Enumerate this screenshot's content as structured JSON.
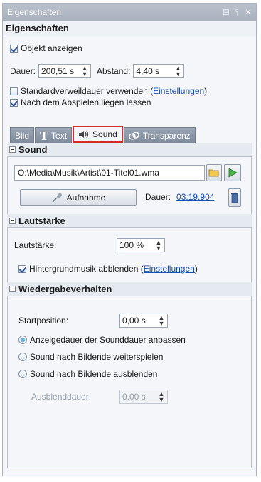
{
  "window": {
    "title": "Eigenschaften",
    "btn_pin": "⊟",
    "btn_float": "⫯",
    "btn_close": "✕"
  },
  "header": {
    "title": "Eigenschaften"
  },
  "general": {
    "show_object": {
      "label": "Objekt anzeigen",
      "checked": true
    },
    "duration_label": "Dauer:",
    "duration_value": "200,51 s",
    "distance_label": "Abstand:",
    "distance_value": "4,40 s",
    "default_duration": {
      "label": "Standardverweildauer verwenden (",
      "link": "Einstellungen",
      "suffix": ")",
      "checked": false
    },
    "stay_after_play": {
      "label": "Nach dem Abspielen liegen lassen",
      "checked": true
    }
  },
  "tabs": [
    {
      "label": "Bild",
      "icon": "picture-icon"
    },
    {
      "label": "Text",
      "icon": "text-icon"
    },
    {
      "label": "Sound",
      "icon": "speaker-icon",
      "active": true
    },
    {
      "label": "Transparenz",
      "icon": "transparency-icon"
    }
  ],
  "sound_section": {
    "title": "Sound",
    "file_path": "O:\\Media\\Musik\\Artist\\01-Titel01.wma",
    "record_button": "Aufnahme",
    "duration_label": "Dauer:",
    "duration_link": "03:19.904"
  },
  "volume_section": {
    "title": "Lautstärke",
    "volume_label": "Lautstärke:",
    "volume_value": "100 %",
    "fade_bg": {
      "label": "Hintergrundmusik abblenden (",
      "link": "Einstellungen",
      "suffix": ")",
      "checked": true
    }
  },
  "playback_section": {
    "title": "Wiedergabeverhalten",
    "start_label": "Startposition:",
    "start_value": "0,00 s",
    "options": [
      {
        "label": "Anzeigedauer der Sounddauer anpassen",
        "selected": true
      },
      {
        "label": "Sound nach Bildende weiterspielen",
        "selected": false
      },
      {
        "label": "Sound nach Bildende ausblenden",
        "selected": false
      }
    ],
    "fade_duration_label": "Ausblenddauer:",
    "fade_duration_value": "0,00 s"
  },
  "colors": {
    "accent_link": "#1b4fb3",
    "active_tab_border": "#d22b2b",
    "titlebar": "#b3bbc6"
  }
}
